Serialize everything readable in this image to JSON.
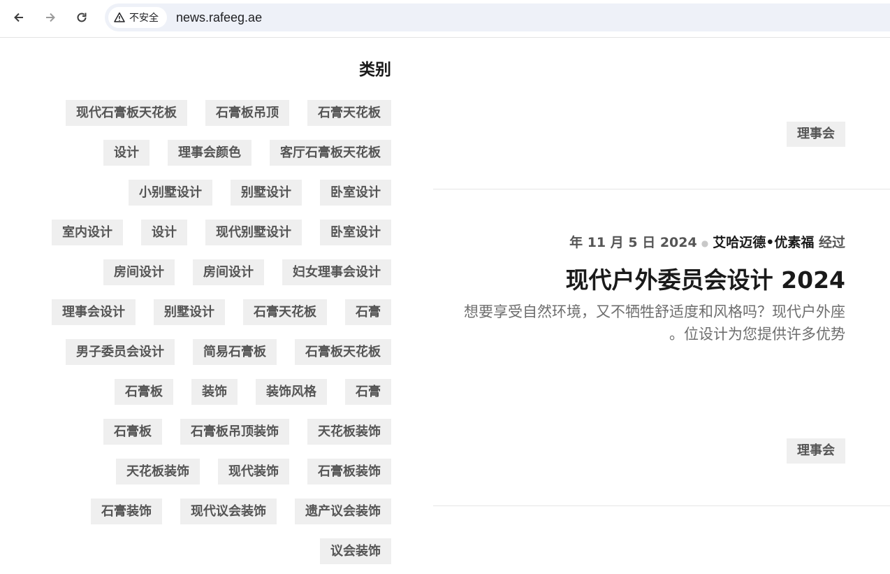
{
  "browser": {
    "security_label": "不安全",
    "url": "news.rafeeg.ae"
  },
  "sidebar": {
    "title": "类别",
    "tags": [
      "现代石膏板天花板",
      "石膏板吊顶",
      "石膏天花板",
      "设计",
      "理事会颜色",
      "客厅石膏板天花板",
      "小别墅设计",
      "别墅设计",
      "卧室设计",
      "室内设计",
      "设计",
      "现代别墅设计",
      "卧室设计",
      "房间设计",
      "房间设计",
      "妇女理事会设计",
      "理事会设计",
      "别墅设计",
      "石膏天花板",
      "石膏",
      "男子委员会设计",
      "简易石膏板",
      "石膏板天花板",
      "石膏板",
      "装饰",
      "装饰风格",
      "石膏",
      "石膏板",
      "石膏板吊顶装饰",
      "天花板装饰",
      "天花板装饰",
      "现代装饰",
      "石膏板装饰",
      "石膏装饰",
      "现代议会装饰",
      "遗产议会装饰",
      "议会装饰"
    ]
  },
  "posts": [
    {
      "tag": "理事会"
    },
    {
      "date": "年 11 月 5 日 2024",
      "author": "艾哈迈德•优素福",
      "by": "经过",
      "title": "现代户外委员会设计 2024",
      "excerpt_line1": "想要享受自然环境，又不牺牲舒适度和风格吗？现代户外座",
      "excerpt_line2": "。位设计为您提供许多优势",
      "tag": "理事会"
    }
  ]
}
